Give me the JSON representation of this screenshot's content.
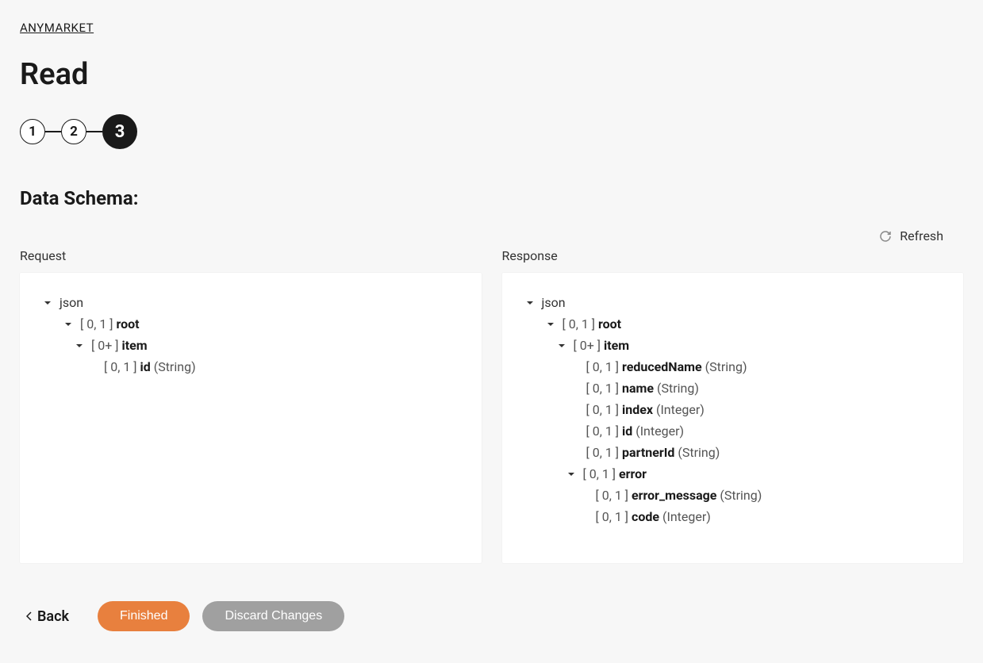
{
  "breadcrumb": {
    "link": "ANYMARKET"
  },
  "page": {
    "title": "Read"
  },
  "stepper": {
    "steps": [
      "1",
      "2",
      "3"
    ],
    "activeIndex": 2
  },
  "section": {
    "title": "Data Schema:"
  },
  "refresh": {
    "label": "Refresh"
  },
  "panels": {
    "request": {
      "label": "Request",
      "tree": [
        {
          "indent": 0,
          "chev": true,
          "label": "json"
        },
        {
          "indent": 1,
          "chev": true,
          "card": "[ 0, 1 ]",
          "name": "root"
        },
        {
          "indent": 2,
          "chev": true,
          "card": "[ 0+ ]",
          "name": "item"
        },
        {
          "indent": 3,
          "chev": false,
          "card": "[ 0, 1 ]",
          "name": "id",
          "type": "(String)"
        }
      ]
    },
    "response": {
      "label": "Response",
      "tree": [
        {
          "indent": 0,
          "chev": true,
          "label": "json"
        },
        {
          "indent": 1,
          "chev": true,
          "card": "[ 0, 1 ]",
          "name": "root"
        },
        {
          "indent": 2,
          "chev": true,
          "card": "[ 0+ ]",
          "name": "item"
        },
        {
          "indent": 3,
          "chev": false,
          "card": "[ 0, 1 ]",
          "name": "reducedName",
          "type": "(String)"
        },
        {
          "indent": 3,
          "chev": false,
          "card": "[ 0, 1 ]",
          "name": "name",
          "type": "(String)"
        },
        {
          "indent": 3,
          "chev": false,
          "card": "[ 0, 1 ]",
          "name": "index",
          "type": "(Integer)"
        },
        {
          "indent": 3,
          "chev": false,
          "card": "[ 0, 1 ]",
          "name": "id",
          "type": "(Integer)"
        },
        {
          "indent": 3,
          "chev": false,
          "card": "[ 0, 1 ]",
          "name": "partnerId",
          "type": "(String)"
        },
        {
          "indent": "2b",
          "chev": true,
          "card": "[ 0, 1 ]",
          "name": "error"
        },
        {
          "indent": "3b",
          "chev": false,
          "card": "[ 0, 1 ]",
          "name": "error_message",
          "type": "(String)"
        },
        {
          "indent": "3b",
          "chev": false,
          "card": "[ 0, 1 ]",
          "name": "code",
          "type": "(Integer)"
        }
      ]
    }
  },
  "footer": {
    "back": "Back",
    "finished": "Finished",
    "discard": "Discard Changes"
  }
}
